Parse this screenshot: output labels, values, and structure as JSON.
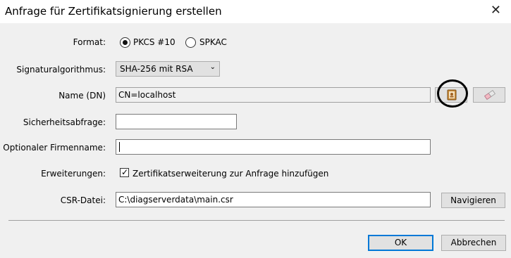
{
  "window": {
    "title": "Anfrage für Zertifikatsignierung erstellen",
    "close_glyph": "✕"
  },
  "format": {
    "label": "Format:",
    "options": [
      {
        "label": "PKCS #10",
        "selected": true
      },
      {
        "label": "SPKAC",
        "selected": false
      }
    ]
  },
  "signature": {
    "label": "Signaturalgorithmus:",
    "value": "SHA-256 mit RSA"
  },
  "name": {
    "label": "Name (DN)",
    "value": "CN=localhost",
    "browse_icon": "address-book-icon",
    "clear_icon": "eraser-icon"
  },
  "challenge": {
    "label": "Sicherheitsabfrage:",
    "value": ""
  },
  "company": {
    "label": "Optionaler Firmenname:",
    "value": ""
  },
  "extensions": {
    "label": "Erweiterungen:",
    "checkbox_label": "Zertifikatserweiterung zur Anfrage hinzufügen",
    "checked": true
  },
  "csr": {
    "label": "CSR-Datei:",
    "value": "C:\\diagserverdata\\main.csr",
    "browse_label": "Navigieren"
  },
  "buttons": {
    "ok": "OK",
    "cancel": "Abbrechen"
  },
  "colors": {
    "annotation_circle": "#000000",
    "default_button_border": "#0078d7"
  }
}
